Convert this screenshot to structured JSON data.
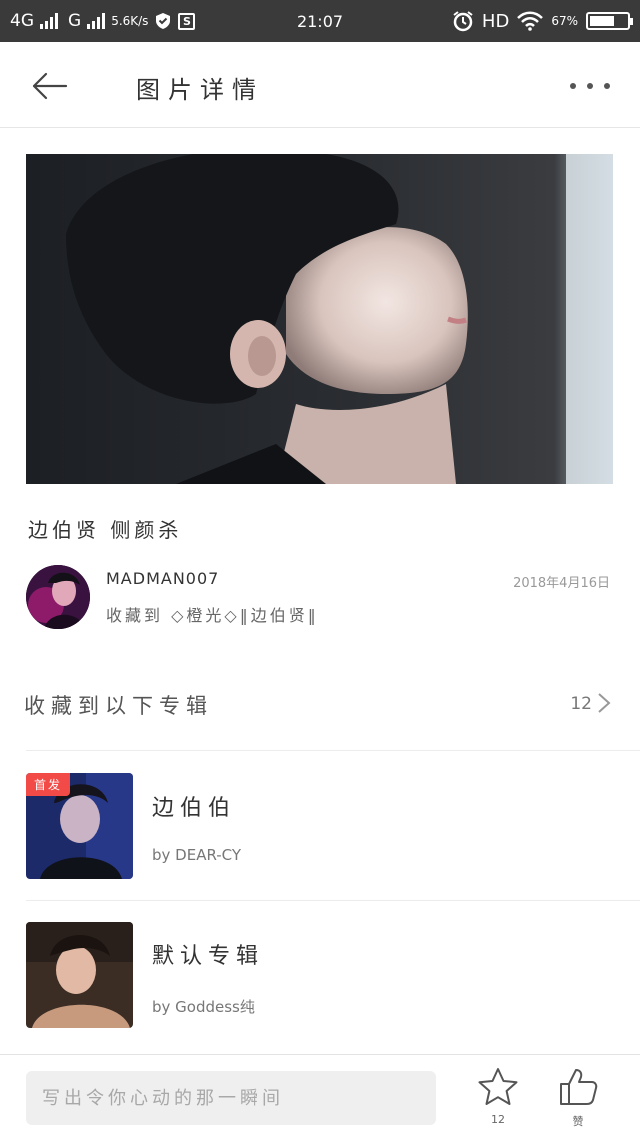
{
  "status_bar": {
    "network_1": "4G",
    "network_2": "G",
    "speed": "5.6K/s",
    "time": "21:07",
    "hd": "HD",
    "battery": "67%",
    "battery_level": 0.67
  },
  "header": {
    "title": "图片详情"
  },
  "photo": {
    "caption": "边伯贤 侧颜杀"
  },
  "uploader": {
    "name": "MADMAN007",
    "date": "2018年4月16日",
    "collected_to": "收藏到 ◇橙光◇‖边伯贤‖"
  },
  "albums": {
    "heading": "收藏到以下专辑",
    "count": "12",
    "items": [
      {
        "title": "边伯伯",
        "by": "by DEAR-CY",
        "badge": "首发"
      },
      {
        "title": "默认专辑",
        "by": "by Goddess纯"
      }
    ]
  },
  "bottom_bar": {
    "comment_placeholder": "写出令你心动的那一瞬间",
    "favorite_count": "12",
    "like_label": "赞"
  },
  "colors": {
    "status_bar_bg": "#3a3a3a",
    "badge_red": "#f24b47",
    "input_bg": "#efefef"
  }
}
